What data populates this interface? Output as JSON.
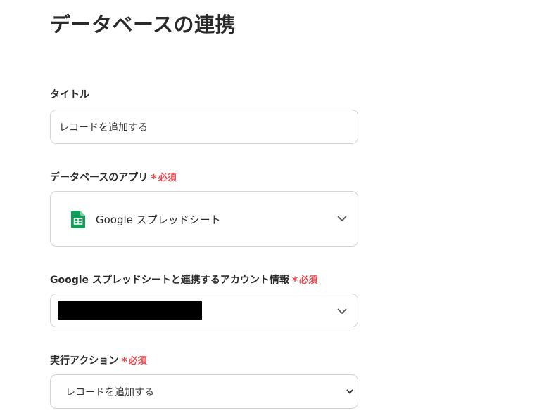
{
  "page": {
    "title": "データベースの連携"
  },
  "fields": {
    "title_field": {
      "label": "タイトル",
      "value": "レコードを追加する"
    },
    "database_app": {
      "label": "データベースのアプリ",
      "required_label": "必須",
      "selected_app": "Google スプレッドシート",
      "app_icon": "google-sheets-icon",
      "app_icon_color": "#0f9d58"
    },
    "account": {
      "label": "Google スプレッドシートと連携するアカウント情報",
      "required_label": "必須"
    },
    "action": {
      "label": "実行アクション",
      "required_label": "必須",
      "selected_value": "レコードを追加する"
    }
  },
  "colors": {
    "required": "#e5484d",
    "border": "#d4d4d8"
  }
}
